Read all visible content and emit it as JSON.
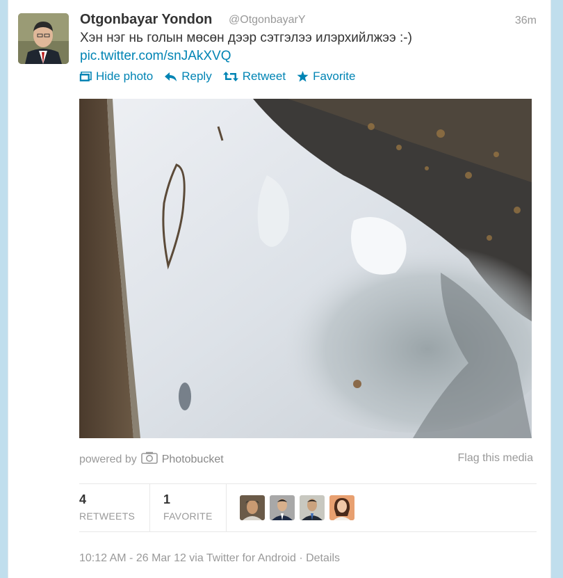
{
  "tweet": {
    "author_name": "Otgonbayar Yondon",
    "author_handle": "@OtgonbayarY",
    "time_ago": "36m",
    "text": "Хэн нэг нь голын мөсөн дээр сэтгэлээ илэрхийлжээ :-)",
    "link": "pic.twitter.com/snJAkXVQ"
  },
  "actions": {
    "hide_photo": "Hide photo",
    "reply": "Reply",
    "retweet": "Retweet",
    "favorite": "Favorite"
  },
  "media": {
    "powered_by": "powered by",
    "provider": "Photobucket",
    "flag": "Flag this media"
  },
  "stats": {
    "retweets_count": "4",
    "retweets_label": "RETWEETS",
    "favorites_count": "1",
    "favorites_label": "FAVORITE"
  },
  "footer": {
    "timestamp": "10:12 AM - 26 Mar 12 via Twitter for Android",
    "separator": "·",
    "details": "Details"
  },
  "colors": {
    "link": "#0084b4",
    "background": "#c0deed"
  }
}
